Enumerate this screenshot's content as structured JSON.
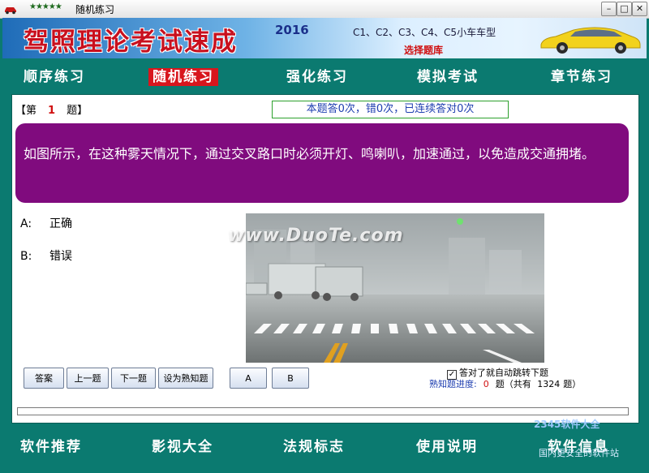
{
  "window": {
    "stars": "★★★★★",
    "title": "随机练习",
    "min": "–",
    "max": "□",
    "close": "✕"
  },
  "banner": {
    "title": "驾照理论考试速成",
    "year": "2016",
    "license_types": "C1、C2、C3、C4、C5小车车型",
    "select_bank": "选择题库"
  },
  "nav": [
    "顺序练习",
    "随机练习",
    "强化练习",
    "模拟考试",
    "章节练习"
  ],
  "question": {
    "prefix": "【第",
    "number": "1",
    "suffix": "题】",
    "status": "本题答0次，错0次，已连续答对0次",
    "text": "如图所示，在这种雾天情况下，通过交叉路口时必须开灯、鸣喇叭，加速通过，以免造成交通拥堵。",
    "options": [
      {
        "key": "A:",
        "label": "正确"
      },
      {
        "key": "B:",
        "label": "错误"
      }
    ]
  },
  "watermark": "www.DuoTe.com",
  "buttons": {
    "answer": "答案",
    "prev": "上一题",
    "next": "下一题",
    "mark_known": "设为熟知题",
    "A": "A",
    "B": "B"
  },
  "auto_jump": {
    "checked": "✓",
    "label": "答对了就自动跳转下题"
  },
  "progress": {
    "label": "熟知题进度:",
    "value": "0",
    "unit": "题（共有",
    "total": "1324",
    "total_suffix": "题）",
    "fraction": 0
  },
  "bottom_nav": [
    "软件推荐",
    "影视大全",
    "法规标志",
    "使用说明",
    "软件信息"
  ],
  "corner": {
    "logo": "2345软件大全",
    "subtitle": "国内更安全的软件站"
  },
  "colors": {
    "background": "#0b7a70",
    "question_bg": "#800b7e",
    "active_tab": "#d8161d",
    "title_red": "#c8101e"
  }
}
